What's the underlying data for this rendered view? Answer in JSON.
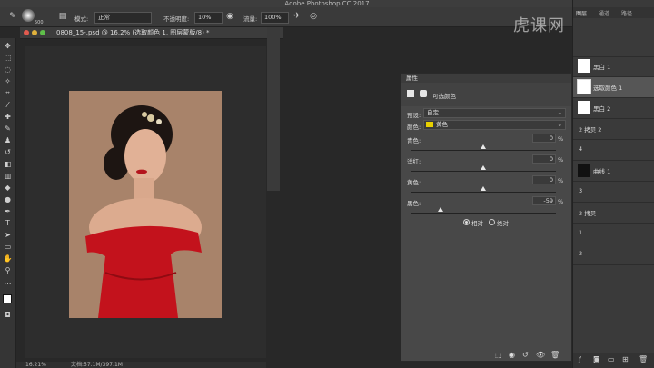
{
  "app": {
    "title": "Adobe Photoshop CC 2017"
  },
  "options_bar": {
    "mode_label": "模式:",
    "mode_value": "正常",
    "opacity_label": "不透明度:",
    "opacity_value": "10%",
    "flow_label": "流量:",
    "flow_value": "100%",
    "brush_size": "500"
  },
  "document": {
    "title": "0808_15-.psd @ 16.2% (选取颜色 1, 图层蒙版/8) *",
    "zoom": "16.21%",
    "doc_info": "文档:57.1M/397.1M"
  },
  "properties": {
    "title": "属性",
    "panel_type": "可选颜色",
    "preset_label": "预设:",
    "preset_value": "自定",
    "colors_label": "颜色:",
    "colors_value": "黄色",
    "swatch_color": "#e8d000",
    "sliders": [
      {
        "label": "青色:",
        "value": "0",
        "unit": "%",
        "level": 0
      },
      {
        "label": "洋红:",
        "value": "0",
        "unit": "%",
        "level": 0
      },
      {
        "label": "黄色:",
        "value": "0",
        "unit": "%",
        "level": 0
      },
      {
        "label": "黑色:",
        "value": "-59",
        "unit": "%",
        "level": -59
      }
    ],
    "method_relative": "相对",
    "method_absolute": "绝对"
  },
  "layers_panel": {
    "tabs": [
      "图层",
      "通道",
      "路径"
    ],
    "items": [
      {
        "name": "黑白 1",
        "thumb": "white"
      },
      {
        "name": "选取颜色 1",
        "thumb": "white"
      },
      {
        "name": "黑白 2",
        "thumb": "white"
      },
      {
        "name": "2 拷贝 2",
        "thumb": "none"
      },
      {
        "name": "4",
        "thumb": "none"
      },
      {
        "name": "曲线 1",
        "thumb": "black"
      },
      {
        "name": "3",
        "thumb": "none"
      },
      {
        "name": "2 拷贝",
        "thumb": "none"
      },
      {
        "name": "1",
        "thumb": "none"
      },
      {
        "name": "2",
        "thumb": "none"
      }
    ]
  },
  "watermark": "虎课网"
}
